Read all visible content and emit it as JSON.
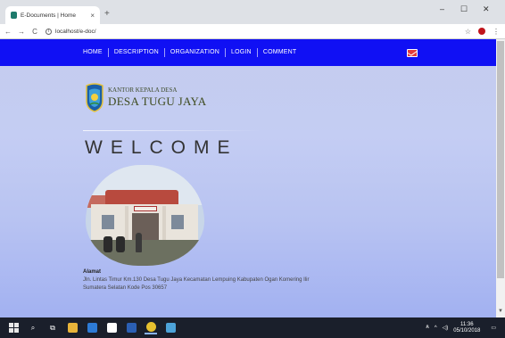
{
  "browser": {
    "tab_title": "E-Documents | Home",
    "tab_close": "×",
    "new_tab": "+",
    "window_controls": {
      "minimize": "–",
      "maximize": "☐",
      "close": "✕"
    },
    "nav": {
      "back": "←",
      "forward": "→",
      "reload": "C"
    },
    "url": "localhost/e-doc/",
    "star": "☆",
    "menu": "⋮"
  },
  "page": {
    "nav_items": [
      "HOME",
      "DESCRIPTION",
      "ORGANIZATION",
      "LOGIN",
      "COMMENT"
    ],
    "logo_line1": "KANTOR KEPALA DESA",
    "logo_line2": "DESA TUGU JAYA",
    "welcome": "WELCOME",
    "address_label": "Alamat",
    "address_text": "Jln. Lintas Timur Km.130 Desa Tugu Jaya Kecamatan Lempuing Kabupaten Ogan Komering Ilir Sumatera Selatan Kode Pos 30657",
    "nav_color": "#1010f4"
  },
  "taskbar": {
    "clock_time": "11:36",
    "clock_date": "05/10/2018",
    "tray_symbols": {
      "people": "ጸ",
      "chevron": "^",
      "volume": "◁)"
    }
  }
}
